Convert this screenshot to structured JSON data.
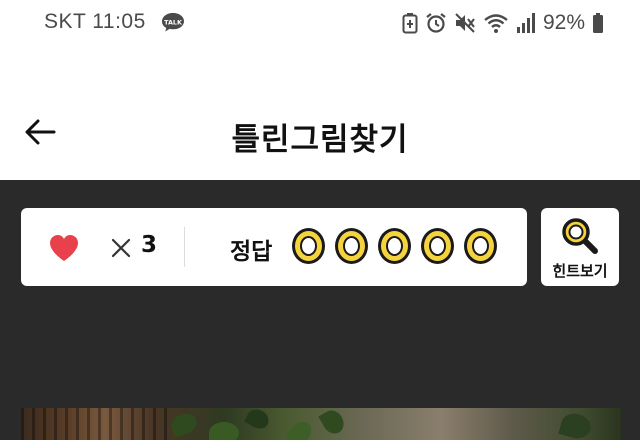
{
  "status_bar": {
    "carrier_time": "SKT 11:05",
    "talk_badge": "TALK",
    "battery_percent": "92%",
    "icons": [
      "talk-icon",
      "battery-saver-icon",
      "alarm-icon",
      "mute-icon",
      "wifi-icon",
      "signal-icon",
      "battery-icon"
    ]
  },
  "app_bar": {
    "title": "틀린그림찾기",
    "back_icon": "back-arrow-icon"
  },
  "scoreboard": {
    "lives_icon": "heart-icon",
    "lives_multiplier": "×",
    "lives_count": "3",
    "answer_label": "정답",
    "answer_slots_total": 5,
    "answer_slots_found": 0
  },
  "hint": {
    "label": "힌트보기",
    "icon": "magnifier-icon"
  },
  "colors": {
    "background": "#2a2a2a",
    "heart": "#e8414b",
    "accent_yellow": "#f5d33c"
  }
}
